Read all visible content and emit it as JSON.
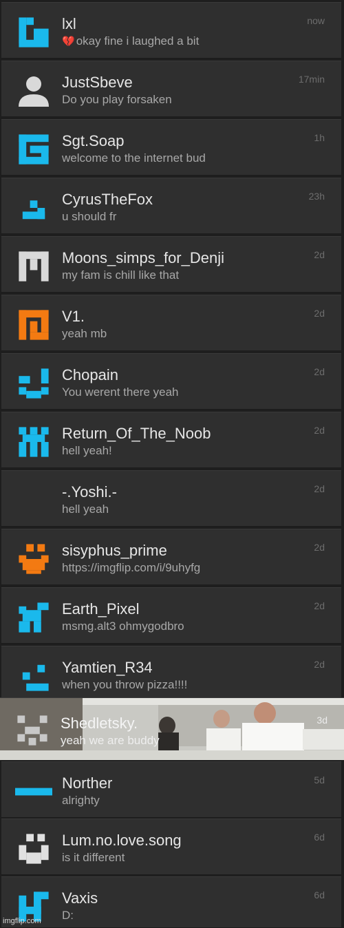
{
  "conversations": [
    {
      "name": "lxl",
      "message": "okay fine i laughed a bit",
      "time": "now",
      "icon": "pixel-glyph-icon",
      "color": "#1ab9ec",
      "heart": "💔"
    },
    {
      "name": "JustSbeve",
      "message": "Do you play forsaken",
      "time": "17min",
      "icon": "default-user-icon",
      "color": "#d9d9d9"
    },
    {
      "name": "Sgt.Soap",
      "message": "welcome to the internet bud",
      "time": "1h",
      "icon": "pixel-glyph-icon",
      "color": "#1ab9ec"
    },
    {
      "name": "CyrusTheFox",
      "message": "u should fr",
      "time": "23h",
      "icon": "pixel-glyph-icon",
      "color": "#1ab9ec"
    },
    {
      "name": "Moons_simps_for_Denji",
      "message": "my fam is chill like that",
      "time": "2d",
      "icon": "pixel-glyph-icon",
      "color": "#d9d9d9"
    },
    {
      "name": "V1.",
      "message": "yeah mb",
      "time": "2d",
      "icon": "pixel-glyph-icon",
      "color": "#f37a12"
    },
    {
      "name": "Chopain",
      "message": "You werent there yeah",
      "time": "2d",
      "icon": "pixel-glyph-icon",
      "color": "#1ab9ec"
    },
    {
      "name": "Return_Of_The_Noob",
      "message": "hell yeah!",
      "time": "2d",
      "icon": "pixel-glyph-icon",
      "color": "#1ab9ec"
    },
    {
      "name": "-.Yoshi.-",
      "message": "hell yeah",
      "time": "2d",
      "icon": "none",
      "color": "#2f2f2f"
    },
    {
      "name": "sisyphus_prime",
      "message": "https://imgflip.com/i/9uhyfg",
      "time": "2d",
      "icon": "pixel-glyph-icon",
      "color": "#f37a12"
    },
    {
      "name": "Earth_Pixel",
      "message": "msmg.alt3 ohmygodbro",
      "time": "2d",
      "icon": "pixel-glyph-icon",
      "color": "#1ab9ec"
    },
    {
      "name": "Yamtien_R34",
      "message": "when you throw pizza!!!!",
      "time": "2d",
      "icon": "pixel-glyph-icon",
      "color": "#1ab9ec"
    },
    {
      "name": "Shedletsky.",
      "message": "yeah we are buddy",
      "time": "3d",
      "icon": "pixel-glyph-icon",
      "color": "#c8c8c8"
    },
    {
      "name": "Norther",
      "message": "alrighty",
      "time": "5d",
      "icon": "pixel-glyph-icon",
      "color": "#1ab9ec"
    },
    {
      "name": "Lum.no.love.song",
      "message": "is it different",
      "time": "6d",
      "icon": "pixel-glyph-icon",
      "color": "#e0e0e0"
    },
    {
      "name": "Vaxis",
      "message": "D:",
      "time": "6d",
      "icon": "pixel-glyph-icon",
      "color": "#1ab9ec"
    }
  ],
  "watermark": "imgflip.com"
}
